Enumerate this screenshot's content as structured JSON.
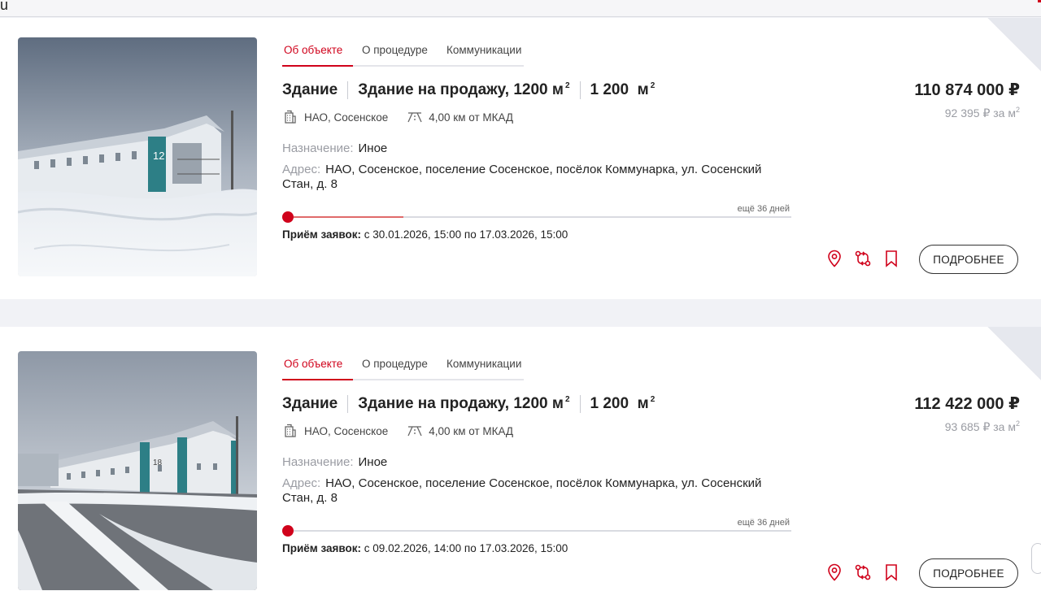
{
  "top_fragment": "u",
  "listings": [
    {
      "tabs": [
        "Об объекте",
        "О процедуре",
        "Коммуникации"
      ],
      "type": "Здание",
      "name": "Здание на продажу, 1200 м",
      "name_sup": "2",
      "area_value": "1 200",
      "area_unit": "м",
      "area_sup": "2",
      "location": "НАО, Сосенское",
      "distance": "4,00 км от МКАД",
      "purpose_label": "Назначение:",
      "purpose_value": "Иное",
      "address_label": "Адрес:",
      "address_value": "НАО, Сосенское, поселение Сосенское, посёлок Коммунарка, ул. Сосенский Стан, д. 8",
      "days_left": "ещё 36 дней",
      "progress": 0.22,
      "intake_label": "Приём заявок:",
      "intake_value": "с 30.01.2026, 15:00 по 17.03.2026, 15:00",
      "price": "110 874 000 ₽",
      "price_per_m": "92 395 ₽ за м",
      "price_per_m_sup": "2",
      "more_label": "ПОДРОБНЕЕ"
    },
    {
      "tabs": [
        "Об объекте",
        "О процедуре",
        "Коммуникации"
      ],
      "type": "Здание",
      "name": "Здание на продажу, 1200 м",
      "name_sup": "2",
      "area_value": "1 200",
      "area_unit": "м",
      "area_sup": "2",
      "location": "НАО, Сосенское",
      "distance": "4,00 км от МКАД",
      "purpose_label": "Назначение:",
      "purpose_value": "Иное",
      "address_label": "Адрес:",
      "address_value": "НАО, Сосенское, поселение Сосенское, посёлок Коммунарка, ул. Сосенский Стан, д. 8",
      "days_left": "ещё 36 дней",
      "progress": 0,
      "intake_label": "Приём заявок:",
      "intake_value": "с 09.02.2026, 14:00 по 17.03.2026, 15:00",
      "price": "112 422 000 ₽",
      "price_per_m": "93 685 ₽ за м",
      "price_per_m_sup": "2",
      "more_label": "ПОДРОБНЕЕ"
    }
  ],
  "colors": {
    "accent": "#d0021b",
    "muted": "#9a9ca3",
    "page_bg": "#f1f2f6"
  },
  "icons": {
    "location": "building-icon",
    "distance": "road-icon",
    "map": "map-pin-icon",
    "route": "route-icon",
    "favorite": "bookmark-icon"
  }
}
